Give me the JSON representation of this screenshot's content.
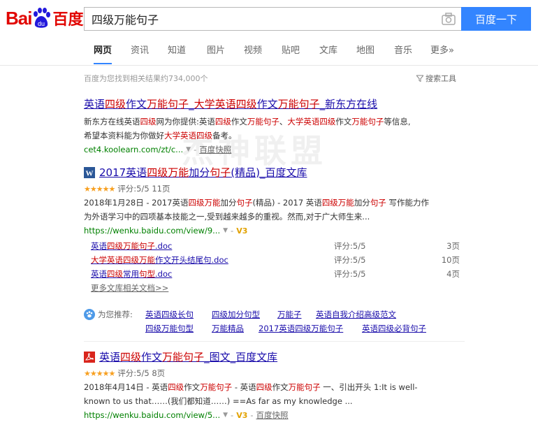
{
  "logo": {
    "latin": "Bai",
    "du": "du",
    "cn": "百度"
  },
  "search": {
    "query": "四级万能句子",
    "button": "百度一下"
  },
  "tabs": [
    "网页",
    "资讯",
    "知道",
    "图片",
    "视频",
    "贴吧",
    "文库",
    "地图",
    "音乐",
    "更多»"
  ],
  "meta": {
    "count_text": "百度为您找到相关结果约734,000个",
    "tools": "搜索工具"
  },
  "results": [
    {
      "title_parts": [
        [
          "英语",
          ""
        ],
        [
          "四级",
          "em"
        ],
        [
          "作文",
          ""
        ],
        [
          "万能句子",
          "em"
        ],
        [
          "_",
          ""
        ],
        [
          "大学英语四级",
          "em"
        ],
        [
          "作文",
          ""
        ],
        [
          "万能句子",
          "em"
        ],
        [
          "_新东方在线",
          ""
        ]
      ],
      "desc_line1": [
        [
          "新东方在线英语",
          ""
        ],
        [
          "四级",
          "em"
        ],
        [
          "网为你提供:英语",
          ""
        ],
        [
          "四级",
          "em"
        ],
        [
          "作文",
          ""
        ],
        [
          "万能句子",
          "em"
        ],
        [
          "、",
          ""
        ],
        [
          "大学英语四级",
          "em"
        ],
        [
          "作文",
          ""
        ],
        [
          "万能句子",
          "em"
        ],
        [
          "等信息,",
          ""
        ]
      ],
      "desc_line2": [
        [
          "希望本资料能为你做好",
          ""
        ],
        [
          "大学英语四级",
          "em"
        ],
        [
          "备考。",
          ""
        ]
      ],
      "url": "cet4.koolearn.com/zt/c...",
      "snapshot": "百度快照"
    },
    {
      "title_parts": [
        [
          "2017英语",
          ""
        ],
        [
          "四级万能",
          "em"
        ],
        [
          "加分",
          ""
        ],
        [
          "句子",
          "em"
        ],
        [
          "(精品)_百度文库",
          ""
        ]
      ],
      "stars": "★★★★★",
      "rating": "评分:5/5 11页",
      "desc_line1": [
        [
          "2018年1月28日 - 2017英语",
          ""
        ],
        [
          "四级万能",
          "em"
        ],
        [
          "加分",
          ""
        ],
        [
          "句子",
          "em"
        ],
        [
          "(精品) - 2017 英语",
          ""
        ],
        [
          "四级万能",
          "em"
        ],
        [
          "加分",
          ""
        ],
        [
          "句子",
          "em"
        ],
        [
          " 写作能力作",
          ""
        ]
      ],
      "desc_line2": [
        [
          "为外语学习中的四项基本技能之一,受到越来越多的重视。然而,对于广大师生来...",
          ""
        ]
      ],
      "url": "https://wenku.baidu.com/view/9...",
      "vip": "V3"
    },
    {
      "title_parts": [
        [
          "英语",
          ""
        ],
        [
          "四级",
          "em"
        ],
        [
          "作文",
          ""
        ],
        [
          "万能句子",
          "em"
        ],
        [
          "_图文_百度文库",
          ""
        ]
      ],
      "stars": "★★★★★",
      "rating": "评分:5/5 8页",
      "desc_line1": [
        [
          "2018年4月14日 - 英语",
          ""
        ],
        [
          "四级",
          "em"
        ],
        [
          "作文",
          ""
        ],
        [
          "万能句子",
          "em"
        ],
        [
          " - 英语",
          ""
        ],
        [
          "四级",
          "em"
        ],
        [
          "作文",
          ""
        ],
        [
          "万能句子",
          "em"
        ],
        [
          " 一、引出开头 1:It is well-",
          ""
        ]
      ],
      "desc_line2": [
        [
          "known to us that……(我们都知道……) ==As far as my knowledge ...",
          ""
        ]
      ],
      "url": "https://wenku.baidu.com/view/5...",
      "vip": "V3",
      "snapshot": "百度快照"
    }
  ],
  "sub_docs": [
    {
      "title_parts": [
        [
          "英语",
          ""
        ],
        [
          "四级万能句子",
          "em"
        ],
        [
          ".doc",
          ""
        ]
      ],
      "score": "评分:5/5",
      "pages": "3页"
    },
    {
      "title_parts": [
        [
          "大学英语四级万能",
          "em"
        ],
        [
          "作文开头结尾句.doc",
          ""
        ]
      ],
      "score": "评分:5/5",
      "pages": "10页"
    },
    {
      "title_parts": [
        [
          "英语",
          ""
        ],
        [
          "四级",
          "em"
        ],
        [
          "常用",
          ""
        ],
        [
          "句型",
          "em"
        ],
        [
          ".doc",
          ""
        ]
      ],
      "score": "评分:5/5",
      "pages": "4页"
    }
  ],
  "more_docs": "更多文库相关文档>>",
  "recommend": {
    "label": "为您推荐:",
    "row1": [
      "英语四级长句",
      "四级加分句型",
      "万能子",
      "英语自我介绍高级范文"
    ],
    "row2": [
      "四级万能句型",
      "万能精品",
      "2017英语四级万能句子",
      "英语四级必背句子"
    ]
  },
  "watermark": "杰神联盟"
}
